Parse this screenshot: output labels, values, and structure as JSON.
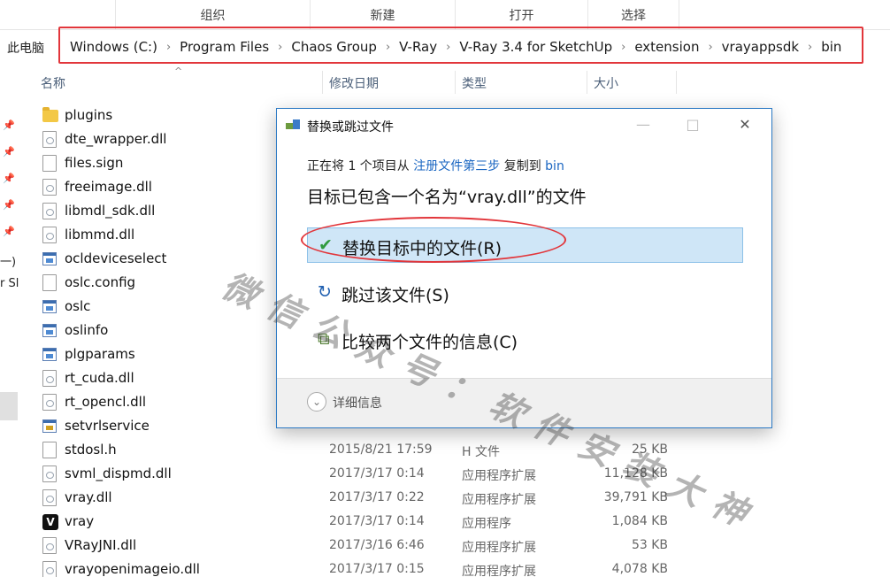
{
  "ribbon": {
    "groups": [
      "组织",
      "新建",
      "打开",
      "选择"
    ]
  },
  "address": {
    "pc_label": "此电脑",
    "crumbs": [
      "Windows (C:)",
      "Program Files",
      "Chaos Group",
      "V-Ray",
      "V-Ray 3.4 for SketchUp",
      "extension",
      "vrayappsdk",
      "bin"
    ]
  },
  "nav": {
    "text1": "一)",
    "text2": "r Sl"
  },
  "columns": {
    "name": "名称",
    "date": "修改日期",
    "type": "类型",
    "size": "大小"
  },
  "files": [
    {
      "name": "plugins",
      "icon": "folder-icon",
      "date": "",
      "type": "",
      "size": ""
    },
    {
      "name": "dte_wrapper.dll",
      "icon": "dll-file-icon",
      "date": "",
      "type": "",
      "size": ""
    },
    {
      "name": "files.sign",
      "icon": "file-icon",
      "date": "",
      "type": "",
      "size": ""
    },
    {
      "name": "freeimage.dll",
      "icon": "dll-file-icon",
      "date": "",
      "type": "",
      "size": ""
    },
    {
      "name": "libmdl_sdk.dll",
      "icon": "dll-file-icon",
      "date": "",
      "type": "",
      "size": ""
    },
    {
      "name": "libmmd.dll",
      "icon": "dll-file-icon",
      "date": "",
      "type": "",
      "size": ""
    },
    {
      "name": "ocldeviceselect",
      "icon": "exe-icon",
      "date": "",
      "type": "",
      "size": ""
    },
    {
      "name": "oslc.config",
      "icon": "file-icon",
      "date": "",
      "type": "",
      "size": ""
    },
    {
      "name": "oslc",
      "icon": "exe-icon",
      "date": "",
      "type": "",
      "size": ""
    },
    {
      "name": "oslinfo",
      "icon": "exe-icon",
      "date": "",
      "type": "",
      "size": ""
    },
    {
      "name": "plgparams",
      "icon": "exe-icon",
      "date": "",
      "type": "",
      "size": ""
    },
    {
      "name": "rt_cuda.dll",
      "icon": "dll-file-icon",
      "date": "",
      "type": "",
      "size": ""
    },
    {
      "name": "rt_opencl.dll",
      "icon": "dll-file-icon",
      "date": "",
      "type": "",
      "size": ""
    },
    {
      "name": "setvrlservice",
      "icon": "service-exe-icon",
      "date": "",
      "type": "",
      "size": ""
    },
    {
      "name": "stdosl.h",
      "icon": "file-icon",
      "date": "2015/8/21 17:59",
      "type": "H 文件",
      "size": "25 KB"
    },
    {
      "name": "svml_dispmd.dll",
      "icon": "dll-file-icon",
      "date": "2017/3/17 0:14",
      "type": "应用程序扩展",
      "size": "11,128 KB"
    },
    {
      "name": "vray.dll",
      "icon": "dll-file-icon",
      "date": "2017/3/17 0:22",
      "type": "应用程序扩展",
      "size": "39,791 KB"
    },
    {
      "name": "vray",
      "icon": "vray-app-icon",
      "date": "2017/3/17 0:14",
      "type": "应用程序",
      "size": "1,084 KB"
    },
    {
      "name": "VRayJNI.dll",
      "icon": "dll-file-icon",
      "date": "2017/3/16 6:46",
      "type": "应用程序扩展",
      "size": "53 KB"
    },
    {
      "name": "vrayopenimageio.dll",
      "icon": "dll-file-icon",
      "date": "2017/3/17 0:15",
      "type": "应用程序扩展",
      "size": "4,078 KB"
    }
  ],
  "dialog": {
    "title": "替换或跳过文件",
    "minimize": "—",
    "maximize": "□",
    "close": "✕",
    "progress_prefix": "正在将 1 个项目从 ",
    "source_link": "注册文件第三步",
    "progress_mid": " 复制到 ",
    "dest_link": "bin",
    "message": "目标已包含一个名为“vray.dll”的文件",
    "options": [
      {
        "label": "替换目标中的文件(R)",
        "icon": "✔"
      },
      {
        "label": "跳过该文件(S)",
        "icon": "↻"
      },
      {
        "label": "比较两个文件的信息(C)",
        "icon": "⧉"
      }
    ],
    "details_label": "详细信息"
  },
  "watermark": "微信公众号：软件安装大神",
  "colors": {
    "accent": "#2b79c4",
    "highlight": "#cfe6f7",
    "annotation_red": "#e2363b",
    "link": "#1a66c2"
  }
}
